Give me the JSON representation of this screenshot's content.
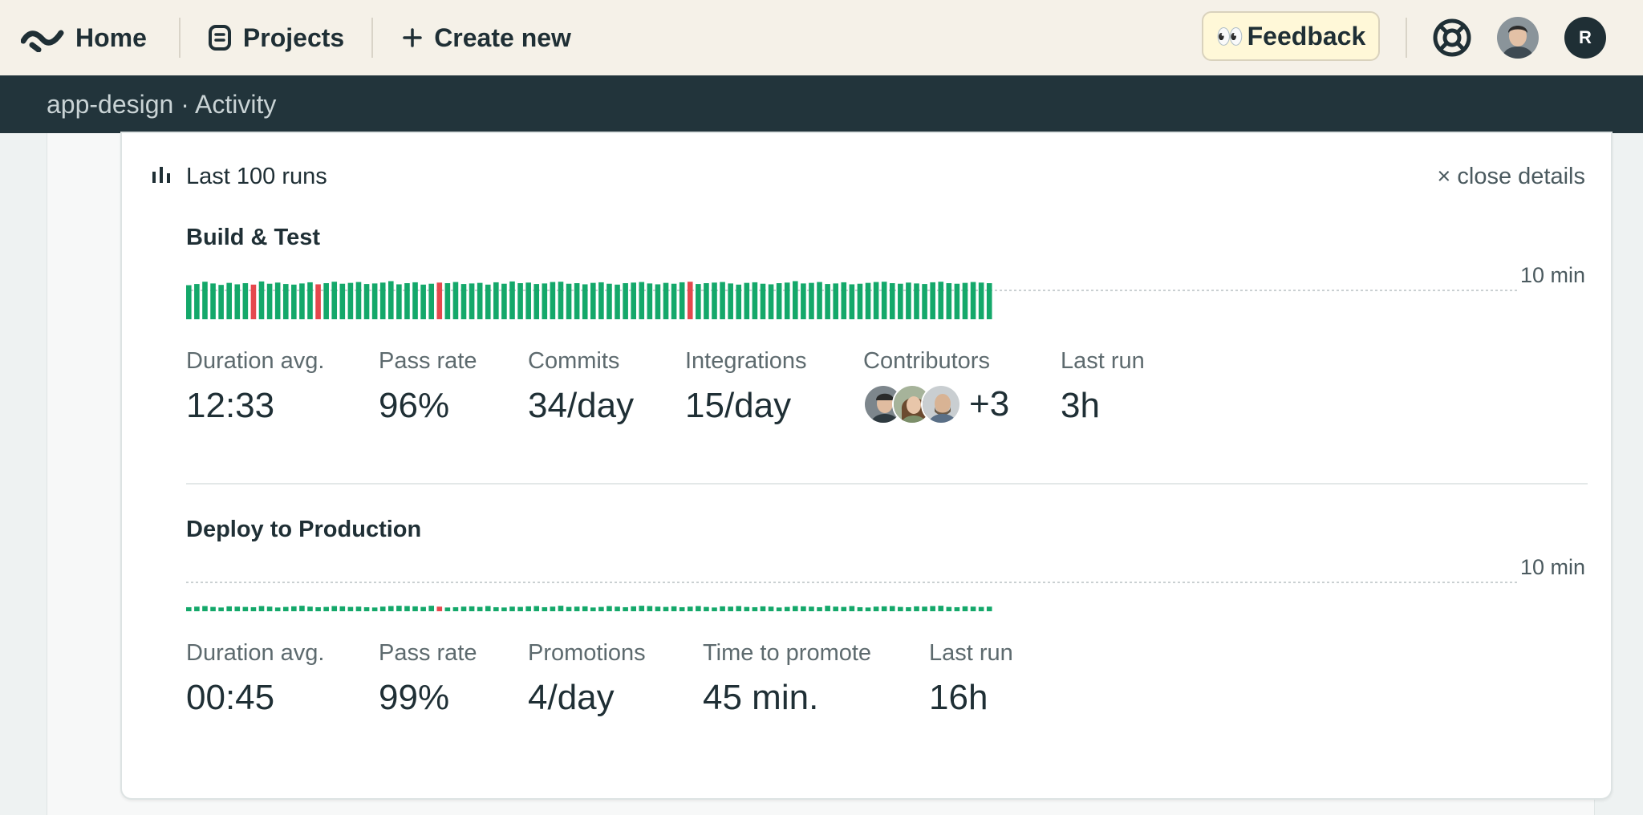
{
  "nav": {
    "home": "Home",
    "projects": "Projects",
    "create_new": "Create new",
    "feedback": "Feedback",
    "feedback_emoji": "👀",
    "user_initial": "R"
  },
  "breadcrumb": "app-design · Activity",
  "panel": {
    "title": "Last 100 runs",
    "close_label": "× close details"
  },
  "colors": {
    "pass": "#14a86a",
    "fail": "#e5484d",
    "nav_bg": "#f5f1e8",
    "subbar_bg": "#22343b"
  },
  "pipelines": [
    {
      "name": "Build & Test",
      "ref_label": "10 min",
      "stats": [
        {
          "label": "Duration avg.",
          "value": "12:33"
        },
        {
          "label": "Pass rate",
          "value": "96%"
        },
        {
          "label": "Commits",
          "value": "34/day"
        },
        {
          "label": "Integrations",
          "value": "15/day"
        },
        {
          "label": "Contributors",
          "value": "+3"
        },
        {
          "label": "Last run",
          "value": "3h"
        }
      ],
      "runs": {
        "duration_min": [
          11.8,
          12.2,
          13.0,
          12.4,
          11.9,
          12.6,
          12.1,
          12.5,
          12.0,
          13.1,
          12.3,
          12.7,
          12.2,
          12.0,
          12.4,
          12.8,
          12.1,
          12.5,
          13.0,
          12.3,
          12.6,
          12.9,
          12.2,
          12.4,
          12.7,
          13.2,
          12.1,
          12.5,
          12.8,
          12.0,
          12.3,
          12.7,
          12.5,
          12.9,
          12.2,
          12.4,
          12.6,
          12.0,
          12.8,
          12.3,
          13.1,
          12.5,
          12.7,
          12.2,
          12.4,
          12.9,
          13.0,
          12.3,
          12.5,
          12.1,
          12.6,
          12.8,
          12.3,
          12.0,
          12.5,
          12.7,
          12.9,
          12.4,
          12.1,
          12.6,
          12.3,
          12.8,
          13.0,
          12.2,
          12.5,
          12.7,
          12.9,
          12.4,
          12.0,
          12.6,
          12.8,
          12.3,
          12.1,
          12.5,
          12.7,
          13.2,
          12.4,
          12.6,
          12.9,
          12.2,
          12.4,
          12.8,
          12.1,
          12.3,
          12.6,
          12.9,
          13.0,
          12.5,
          12.3,
          12.7,
          12.4,
          12.2,
          12.8,
          13.0,
          12.5,
          12.3,
          12.6,
          12.9,
          12.7,
          12.5
        ],
        "failed_runs": [
          8,
          16,
          31,
          62
        ]
      }
    },
    {
      "name": "Deploy to Production",
      "ref_label": "10 min",
      "stats": [
        {
          "label": "Duration avg.",
          "value": "00:45"
        },
        {
          "label": "Pass rate",
          "value": "99%"
        },
        {
          "label": "Promotions",
          "value": "4/day"
        },
        {
          "label": "Time to promote",
          "value": "45 min."
        },
        {
          "label": "Last run",
          "value": "16h"
        }
      ],
      "runs": {
        "duration_min": [
          1.4,
          1.6,
          1.8,
          1.5,
          1.3,
          1.7,
          1.6,
          1.5,
          1.4,
          1.8,
          1.6,
          1.3,
          1.5,
          1.7,
          1.9,
          1.6,
          1.4,
          1.5,
          1.8,
          1.7,
          1.5,
          1.6,
          1.4,
          1.3,
          1.6,
          1.8,
          1.9,
          1.8,
          1.7,
          1.5,
          1.9,
          1.6,
          1.3,
          1.4,
          1.6,
          1.7,
          1.5,
          1.8,
          1.4,
          1.3,
          1.6,
          1.5,
          1.7,
          1.8,
          1.4,
          1.6,
          1.9,
          1.5,
          1.6,
          1.7,
          1.3,
          1.5,
          1.8,
          1.6,
          1.4,
          1.7,
          1.9,
          1.8,
          1.6,
          1.5,
          1.7,
          1.4,
          1.6,
          1.8,
          1.5,
          1.3,
          1.7,
          1.6,
          1.8,
          1.5,
          1.4,
          1.7,
          1.6,
          1.3,
          1.5,
          1.8,
          1.7,
          1.6,
          1.4,
          1.9,
          1.6,
          1.5,
          1.8,
          1.4,
          1.3,
          1.6,
          1.7,
          1.8,
          1.5,
          1.4,
          1.7,
          1.6,
          1.8,
          1.9,
          1.5,
          1.4,
          1.7,
          1.6,
          1.5,
          1.6
        ],
        "failed_runs": [
          31
        ]
      }
    }
  ]
}
